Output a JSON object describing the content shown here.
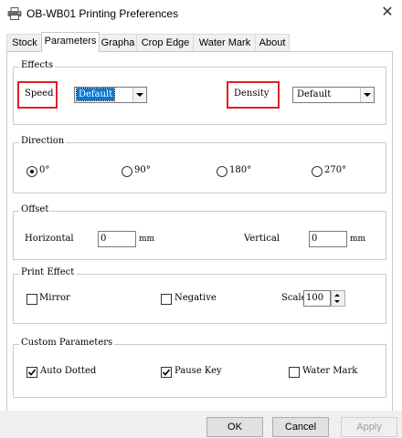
{
  "window": {
    "title": "OB-WB01 Printing Preferences",
    "close_glyph": "✕",
    "app_icon": "printer-icon"
  },
  "tabs": [
    {
      "label": "Stock",
      "active": false
    },
    {
      "label": "Parameters",
      "active": true
    },
    {
      "label": "Grapha",
      "active": false
    },
    {
      "label": "Crop Edge",
      "active": false
    },
    {
      "label": "Water Mark",
      "active": false
    },
    {
      "label": "About",
      "active": false
    }
  ],
  "effects": {
    "legend": "Effects",
    "speed_label": "Speed",
    "speed_value": "Default",
    "density_label": "Density",
    "density_value": "Default",
    "highlight_color": "#e02020"
  },
  "direction": {
    "legend": "Direction",
    "options": [
      "0°",
      "90°",
      "180°",
      "270°"
    ],
    "selected": "0°"
  },
  "offset": {
    "legend": "Offset",
    "horizontal_label": "Horizontal",
    "horizontal_value": "0",
    "horizontal_unit": "mm",
    "vertical_label": "Vertical",
    "vertical_value": "0",
    "vertical_unit": "mm"
  },
  "print_effect": {
    "legend": "Print Effect",
    "mirror_label": "Mirror",
    "mirror_checked": false,
    "negative_label": "Negative",
    "negative_checked": false,
    "scale_label": "Scale",
    "scale_value": "100"
  },
  "custom": {
    "legend": "Custom Parameters",
    "auto_dotted_label": "Auto Dotted",
    "auto_dotted_checked": true,
    "pause_key_label": "Pause Key",
    "pause_key_checked": true,
    "water_mark_label": "Water Mark",
    "water_mark_checked": false
  },
  "buttons": {
    "ok": "OK",
    "cancel": "Cancel",
    "apply": "Apply"
  }
}
